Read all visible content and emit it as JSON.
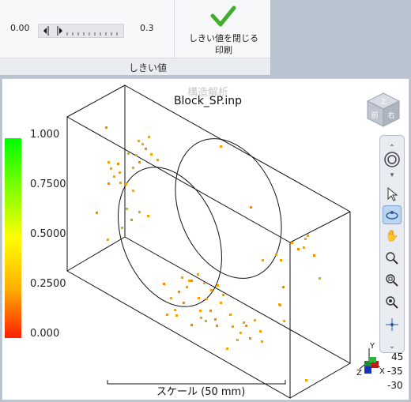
{
  "ribbon": {
    "threshold_min": "0.00",
    "threshold_max": "0.3",
    "group_label": "しきい値",
    "close_button_label": "しきい値を閉じる\n印刷"
  },
  "viewport": {
    "faint_title": "構造解析",
    "title": "Block_SP.inp",
    "scale_label": "スケール (50 mm)",
    "nav_cube_labels": [
      "上",
      "前",
      "右"
    ],
    "axis_values": [
      "45",
      "-35",
      "-30"
    ],
    "axis_letters": [
      "Y",
      "Z",
      "X"
    ]
  },
  "legend": {
    "labels": [
      "1.000",
      "0.7500",
      "0.5000",
      "0.2500",
      "0.000"
    ],
    "colors": [
      "#00ff00",
      "#ffff00",
      "#ff0000"
    ]
  },
  "colors": {
    "accent_check": "#3fae2a",
    "point_color": "#f4a300"
  }
}
